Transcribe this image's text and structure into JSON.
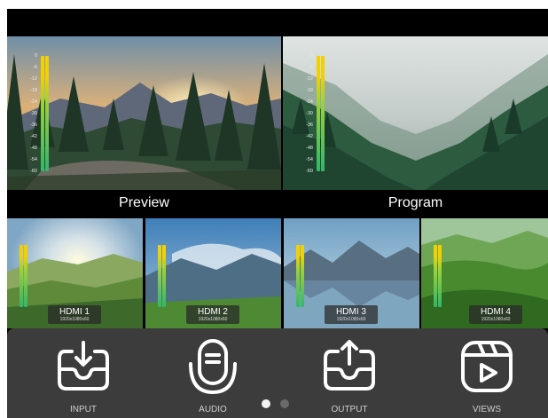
{
  "monitors": {
    "preview_label": "Preview",
    "program_label": "Program",
    "meter_scale": [
      "0",
      "-6",
      "-12",
      "-18",
      "-24",
      "-30",
      "-36",
      "-42",
      "-48",
      "-54",
      "-60"
    ]
  },
  "sources": [
    {
      "name": "HDMI 1",
      "resolution": "1920x1080x60"
    },
    {
      "name": "HDMI 2",
      "resolution": "1920x1080x60"
    },
    {
      "name": "HDMI 3",
      "resolution": "1920x1080x60"
    },
    {
      "name": "HDMI 4",
      "resolution": "1920x1080x60"
    }
  ],
  "toolbar": {
    "input_label": "INPUT",
    "audio_label": "AUDIO",
    "output_label": "OUTPUT",
    "views_label": "VIEWS"
  },
  "pager": {
    "total_pages": 2,
    "current_page": 1
  },
  "colors": {
    "meter_top": "#f5d000",
    "meter_mid": "#9bd23a",
    "meter_bottom": "#2fb86a",
    "toolbar_bg": "#3c3c3c",
    "screen_bg": "#000000"
  }
}
